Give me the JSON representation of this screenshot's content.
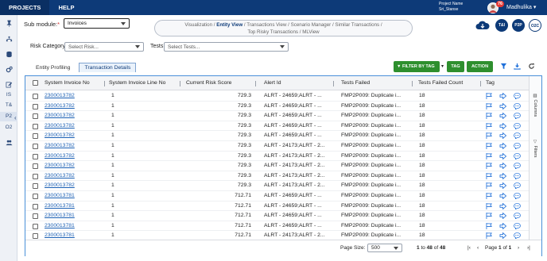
{
  "topbar": {
    "nav": [
      "PROJECTS",
      "HELP"
    ],
    "project_label": "Project Name",
    "project_value": "Sri_Stanse",
    "notif_count": "76",
    "user_name": "Madhulika"
  },
  "sidebar": {
    "items": [
      "IS",
      "T&",
      "P2",
      "O2"
    ]
  },
  "filters": {
    "submodule_label": "Sub module:",
    "submodule_required": "*",
    "submodule_value": "Invoices",
    "risk_label": "Risk Category",
    "risk_placeholder": "Select Risk...",
    "tests_label": "Tests",
    "tests_placeholder": "Select Tests..."
  },
  "breadcrumbs": {
    "line1": [
      "Visualization",
      "Entity View",
      "Transactions View",
      "Scenario Manager",
      "Similar Transactions"
    ],
    "line2": [
      "Top Risky Transactions",
      "MLView"
    ],
    "active": "Entity View",
    "separator": "/"
  },
  "quick_links": [
    "T&I",
    "P2P",
    "O2C"
  ],
  "tabs": [
    "Entity Profiling",
    "Transaction Details"
  ],
  "actions": {
    "filter_by_tag": "FILTER BY TAG",
    "tag": "TAG",
    "action": "ACTION"
  },
  "table": {
    "columns": [
      "System Invoice No",
      "System Invoice Line No",
      "Current Risk Score",
      "Alert Id",
      "Tests Failed",
      "Tests Failed Count",
      "Tag"
    ],
    "rows": [
      [
        "2300013782",
        "1",
        "729.3",
        "ALRT - 24659;ALRT - ...",
        "FMP2P009: Duplicate i...",
        "18"
      ],
      [
        "2300013782",
        "1",
        "729.3",
        "ALRT - 24659;ALRT - ...",
        "FMP2P009: Duplicate i...",
        "18"
      ],
      [
        "2300013782",
        "1",
        "729.3",
        "ALRT - 24659;ALRT - ...",
        "FMP2P009: Duplicate i...",
        "18"
      ],
      [
        "2300013782",
        "1",
        "729.3",
        "ALRT - 24659;ALRT - ...",
        "FMP2P009: Duplicate i...",
        "18"
      ],
      [
        "2300013782",
        "1",
        "729.3",
        "ALRT - 24659;ALRT - ...",
        "FMP2P009: Duplicate i...",
        "18"
      ],
      [
        "2300013782",
        "1",
        "729.3",
        "ALRT - 24173;ALRT - 2...",
        "FMP2P009: Duplicate i...",
        "18"
      ],
      [
        "2300013782",
        "1",
        "729.3",
        "ALRT - 24173;ALRT - 2...",
        "FMP2P009: Duplicate i...",
        "18"
      ],
      [
        "2300013782",
        "1",
        "729.3",
        "ALRT - 24173;ALRT - 2...",
        "FMP2P009: Duplicate i...",
        "18"
      ],
      [
        "2300013782",
        "1",
        "729.3",
        "ALRT - 24173;ALRT - 2...",
        "FMP2P009: Duplicate i...",
        "18"
      ],
      [
        "2300013782",
        "1",
        "729.3",
        "ALRT - 24173;ALRT - 2...",
        "FMP2P009: Duplicate i...",
        "18"
      ],
      [
        "2300013781",
        "1",
        "712.71",
        "ALRT - 24659;ALRT - ...",
        "FMP2P009: Duplicate i...",
        "18"
      ],
      [
        "2300013781",
        "1",
        "712.71",
        "ALRT - 24659;ALRT - ...",
        "FMP2P009: Duplicate i...",
        "18"
      ],
      [
        "2300013781",
        "1",
        "712.71",
        "ALRT - 24659;ALRT - ...",
        "FMP2P009: Duplicate i...",
        "18"
      ],
      [
        "2300013781",
        "1",
        "712.71",
        "ALRT - 24659;ALRT - ...",
        "FMP2P009: Duplicate i...",
        "18"
      ],
      [
        "2300013781",
        "1",
        "712.71",
        "ALRT - 24173;ALRT - 2...",
        "FMP2P009: Duplicate i...",
        "18"
      ]
    ]
  },
  "side_panel": [
    "Columns",
    "Filters"
  ],
  "footer": {
    "page_size_label": "Page Size:",
    "page_size_value": "500",
    "range_from": "1",
    "range_to": "48",
    "range_total": "48",
    "range_to_word": "to",
    "range_of_word": "of",
    "page_word": "Page",
    "page_current": "1",
    "page_of_word": "of",
    "page_total": "1"
  },
  "colors": {
    "brand": "#0d3a78",
    "accent_green": "#2e8f2e",
    "link": "#1a5fb4",
    "tag_icon": "#1e6fd9"
  }
}
